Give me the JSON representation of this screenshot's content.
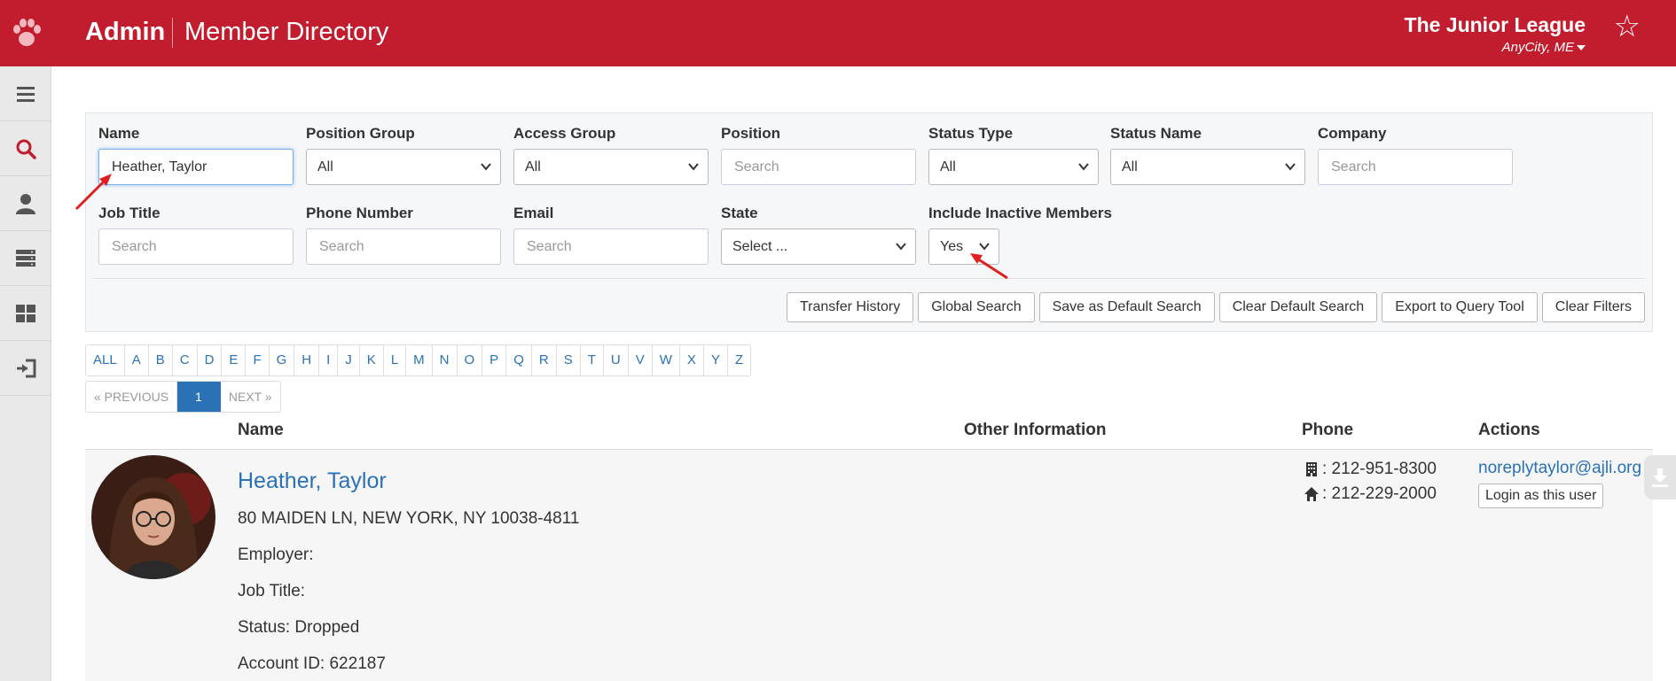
{
  "header": {
    "brand": "Admin",
    "page_title": "Member Directory",
    "org_name": "The Junior League",
    "org_city": "AnyCity, ME"
  },
  "sidebar": {
    "items": [
      {
        "icon": "menu-icon"
      },
      {
        "icon": "search-icon",
        "active": true
      },
      {
        "icon": "user-icon"
      },
      {
        "icon": "server-icon"
      },
      {
        "icon": "dashboard-icon"
      },
      {
        "icon": "logout-icon"
      }
    ]
  },
  "filters": {
    "name": {
      "label": "Name",
      "value": "Heather, Taylor"
    },
    "position_group": {
      "label": "Position Group",
      "value": "All"
    },
    "access_group": {
      "label": "Access Group",
      "value": "All"
    },
    "position": {
      "label": "Position",
      "placeholder": "Search"
    },
    "status_type": {
      "label": "Status Type",
      "value": "All"
    },
    "status_name": {
      "label": "Status Name",
      "value": "All"
    },
    "company": {
      "label": "Company",
      "placeholder": "Search"
    },
    "job_title": {
      "label": "Job Title",
      "placeholder": "Search"
    },
    "phone_number": {
      "label": "Phone Number",
      "placeholder": "Search"
    },
    "email": {
      "label": "Email",
      "placeholder": "Search"
    },
    "state": {
      "label": "State",
      "value": "Select ..."
    },
    "include_inactive": {
      "label": "Include Inactive Members",
      "value": "Yes"
    }
  },
  "buttons": {
    "transfer_history": "Transfer History",
    "global_search": "Global Search",
    "save_default": "Save as Default Search",
    "clear_default": "Clear Default Search",
    "export_query": "Export to Query Tool",
    "clear_filters": "Clear Filters"
  },
  "alphabet": [
    "ALL",
    "A",
    "B",
    "C",
    "D",
    "E",
    "F",
    "G",
    "H",
    "I",
    "J",
    "K",
    "L",
    "M",
    "N",
    "O",
    "P",
    "Q",
    "R",
    "S",
    "T",
    "U",
    "V",
    "W",
    "X",
    "Y",
    "Z"
  ],
  "pager": {
    "previous": "« PREVIOUS",
    "current": "1",
    "next": "NEXT »"
  },
  "table": {
    "headers": {
      "name": "Name",
      "other": "Other Information",
      "phone": "Phone",
      "actions": "Actions"
    }
  },
  "member": {
    "name": "Heather, Taylor",
    "address": "80 MAIDEN LN, NEW YORK, NY 10038-4811",
    "employer": "Employer:",
    "job_title": "Job Title:",
    "status": "Status: Dropped",
    "account_id": "Account ID: 622187",
    "phone_work": ": 212-951-8300",
    "phone_home": ": 212-229-2000",
    "email": "noreplytaylor@ajli.org",
    "login_action": "Login as this user"
  },
  "colors": {
    "brand_red": "#c21d2e",
    "link_blue": "#2a72b5",
    "sidebar_bg": "#e9e9e9"
  }
}
